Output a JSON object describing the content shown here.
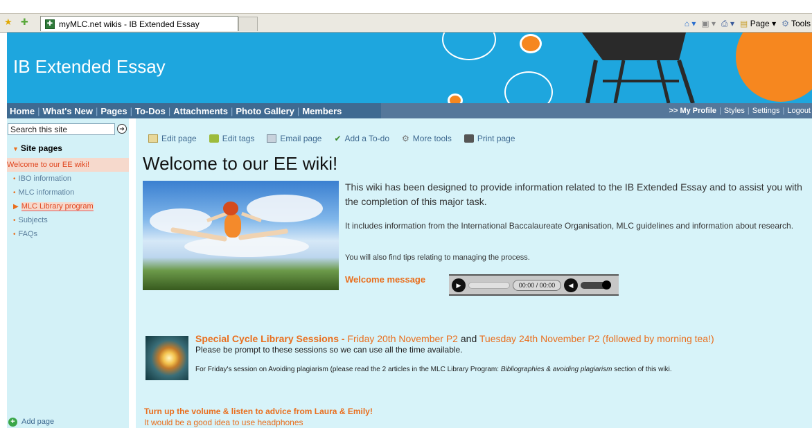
{
  "browser": {
    "tab_title": "myMLC.net wikis - IB Extended Essay",
    "commands": [
      "Page",
      "Tools"
    ]
  },
  "banner": {
    "title": "IB Extended Essay"
  },
  "nav": {
    "tabs": [
      "Home",
      "What's New",
      "Pages",
      "To-Dos",
      "Attachments",
      "Photo Gallery",
      "Members"
    ],
    "right": {
      "profile": ">> My Profile",
      "styles": "Styles",
      "settings": "Settings",
      "logout": "Logout"
    }
  },
  "sidebar": {
    "search_placeholder": "Search this site",
    "site_pages_heading": "Site pages",
    "items": [
      "Welcome to our EE wiki!",
      "IBO information",
      "MLC information",
      "MLC Library program",
      "Subjects",
      "FAQs"
    ],
    "add_page": "Add page"
  },
  "toolbar": {
    "edit_page": "Edit page",
    "edit_tags": "Edit tags",
    "email_page": "Email page",
    "add_todo": "Add a To-do",
    "more_tools": "More tools",
    "print_page": "Print page"
  },
  "main": {
    "title": "Welcome to our EE wiki!",
    "intro": "This wiki has been designed to provide information related to the IB Extended Essay and to assist you with the completion of this major task.",
    "intro_2": "It includes information from the International Baccalaureate Organisation, MLC guidelines and information about research.",
    "intro_3": "You will also find tips relating to managing the process.",
    "welcome_message": "Welcome message",
    "player_time": "00:00 / 00:00",
    "special_title": "Special Cycle Library Sessions",
    "special_dash": " - ",
    "special_date1": "Friday 20th November P2",
    "special_and": " and ",
    "special_date2": "Tuesday 24th November P2 (followed by morning tea!)",
    "special_sub": "Please be prompt to these sessions so we can use all the time available.",
    "special_note_a": "For Friday's session on Avoiding plagiarism (please read the 2 articles in the MLC Library Program: ",
    "special_note_i": "Bibliographies & avoiding plagiarism",
    "special_note_b": " section of this wiki.",
    "volume_head": "Turn up the volume & listen to advice from Laura & Emily!",
    "volume_sub": "It would be a good idea to use headphones"
  },
  "colors": {
    "banner_blue": "#1ea6de",
    "nav_blue": "#3f6a91",
    "accent_orange": "#e96e1d",
    "panel_bg": "#d7f3f9"
  }
}
